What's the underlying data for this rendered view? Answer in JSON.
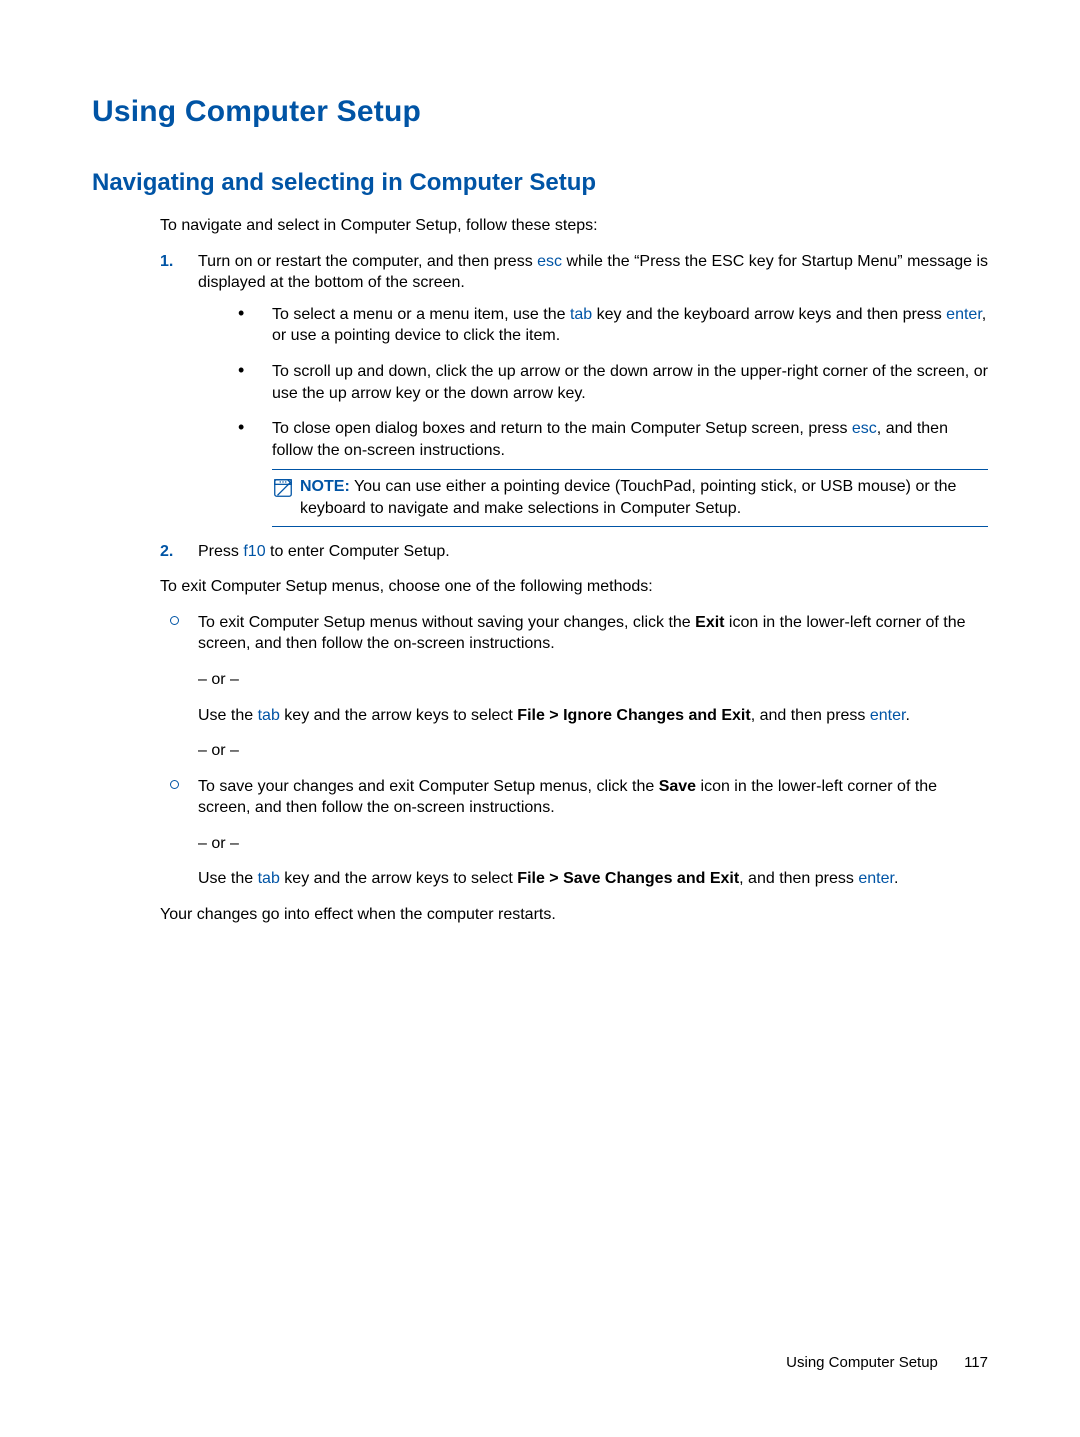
{
  "heading": "Using Computer Setup",
  "subheading": "Navigating and selecting in Computer Setup",
  "intro": "To navigate and select in Computer Setup, follow these steps:",
  "steps": {
    "s1": {
      "num": "1.",
      "pre": "Turn on or restart the computer, and then press ",
      "k1": "esc",
      "post": " while the “Press the ESC key for Startup Menu” message is displayed at the bottom of the screen."
    },
    "b1": {
      "pre": "To select a menu or a menu item, use the ",
      "k1": "tab",
      "mid": " key and the keyboard arrow keys and then press ",
      "k2": "enter",
      "post": ", or use a pointing device to click the item."
    },
    "b2": "To scroll up and down, click the up arrow or the down arrow in the upper-right corner of the screen, or use the up arrow key or the down arrow key.",
    "b3": {
      "pre": "To close open dialog boxes and return to the main Computer Setup screen, press ",
      "k1": "esc",
      "post": ", and then follow the on-screen instructions."
    },
    "note": {
      "label": "NOTE:",
      "text": "   You can use either a pointing device (TouchPad, pointing stick, or USB mouse) or the keyboard to navigate and make selections in Computer Setup."
    },
    "s2": {
      "num": "2.",
      "pre": "Press ",
      "k1": "f10",
      "post": " to enter Computer Setup."
    }
  },
  "exit_intro": "To exit Computer Setup menus, choose one of the following methods:",
  "exit": {
    "e1": {
      "pre": "To exit Computer Setup menus without saving your changes, click the ",
      "b1": "Exit",
      "post": " icon in the lower-left corner of the screen, and then follow the on-screen instructions."
    },
    "or": "– or –",
    "e1b": {
      "pre": "Use the ",
      "k1": "tab",
      "mid": " key and the arrow keys to select ",
      "b1": "File > Ignore Changes and Exit",
      "mid2": ", and then press ",
      "k2": "enter",
      "post": "."
    },
    "e2": {
      "pre": "To save your changes and exit Computer Setup menus, click the ",
      "b1": "Save",
      "post": " icon in the lower-left corner of the screen, and then follow the on-screen instructions."
    },
    "e2b": {
      "pre": "Use the ",
      "k1": "tab",
      "mid": " key and the arrow keys to select ",
      "b1": "File > Save Changes and Exit",
      "mid2": ", and then press ",
      "k2": "enter",
      "post": "."
    }
  },
  "closing": "Your changes go into effect when the computer restarts.",
  "footer": {
    "section": "Using Computer Setup",
    "page": "117"
  }
}
